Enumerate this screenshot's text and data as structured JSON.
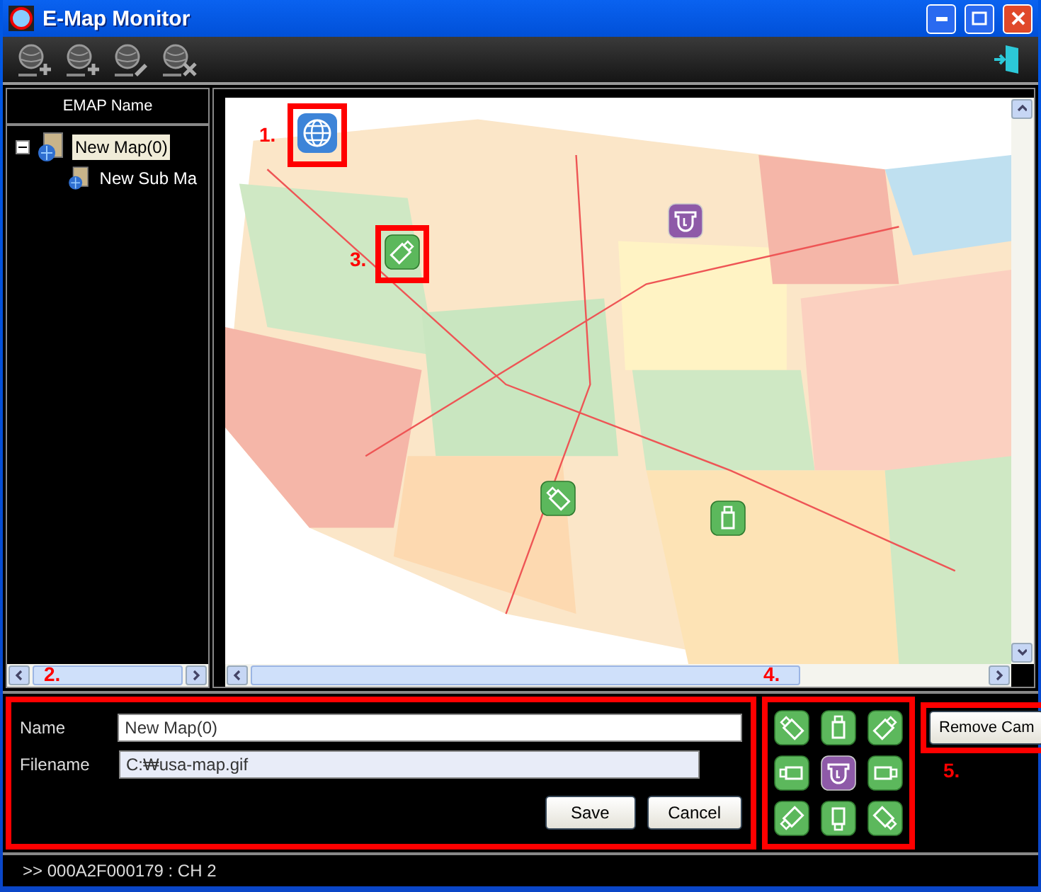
{
  "window": {
    "title": "E-Map Monitor"
  },
  "toolbar": {
    "buttons": [
      {
        "kind": "add"
      },
      {
        "kind": "add-sub"
      },
      {
        "kind": "edit"
      },
      {
        "kind": "delete"
      }
    ],
    "exit": {
      "kind": "exit"
    }
  },
  "tree": {
    "header": "EMAP Name",
    "items": [
      {
        "label": "New Map(0)",
        "selected": true,
        "expanded": true,
        "children": [
          {
            "label": "New Sub Ma",
            "selected": false
          }
        ]
      }
    ],
    "scroll_annotation": "2."
  },
  "map": {
    "kind": "picture",
    "markers": [
      {
        "kind": "globe",
        "annotation": "1."
      },
      {
        "kind": "camera-ne",
        "annotation": "3."
      },
      {
        "kind": "dome"
      },
      {
        "kind": "camera-nw"
      },
      {
        "kind": "camera-n"
      }
    ],
    "scroll_annotation": "4."
  },
  "form": {
    "fields": [
      {
        "label": "Name",
        "value": "New Map(0)",
        "disabled": false
      },
      {
        "label": "Filename",
        "value": "C:₩usa-map.gif",
        "disabled": true
      }
    ],
    "buttons": [
      "Save",
      "Cancel"
    ],
    "highlighted": true
  },
  "palette": {
    "highlighted": true,
    "items": [
      {
        "kind": "camera-nw",
        "color": "#5cb85c"
      },
      {
        "kind": "camera-n",
        "color": "#5cb85c"
      },
      {
        "kind": "camera-ne",
        "color": "#5cb85c"
      },
      {
        "kind": "camera-w",
        "color": "#5cb85c"
      },
      {
        "kind": "dome",
        "color": "#8e5aa8"
      },
      {
        "kind": "camera-e",
        "color": "#5cb85c"
      },
      {
        "kind": "camera-sw",
        "color": "#5cb85c"
      },
      {
        "kind": "camera-s",
        "color": "#5cb85c"
      },
      {
        "kind": "camera-se",
        "color": "#5cb85c"
      }
    ]
  },
  "remove_button": {
    "label": "Remove Cam",
    "annotation": "5."
  },
  "status_bar": {
    "text": ">> 000A2F000179 : CH 2"
  }
}
